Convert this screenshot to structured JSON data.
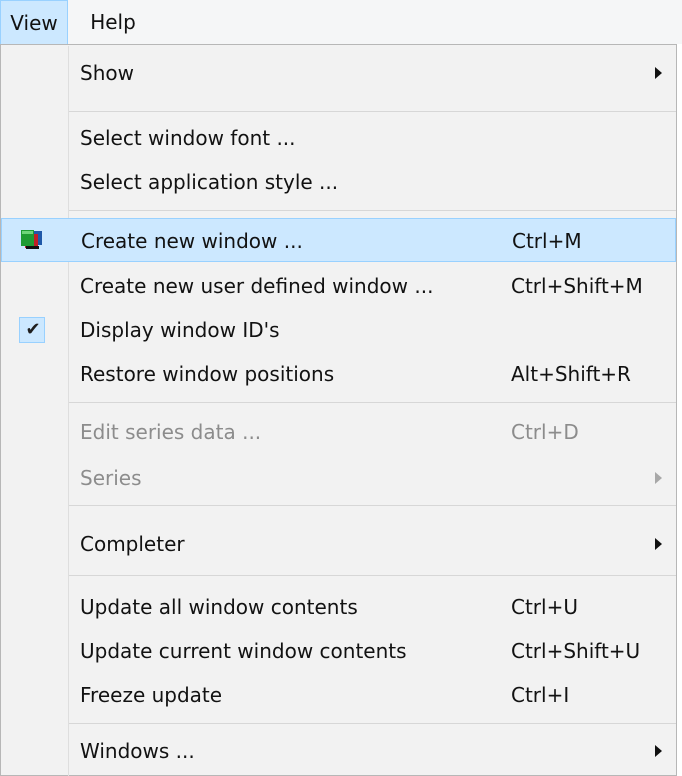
{
  "menubar": {
    "items": [
      {
        "label": "View"
      },
      {
        "label": "Help"
      }
    ]
  },
  "dropdown": {
    "items": [
      {
        "label": "Show",
        "shortcut": "",
        "submenu": true,
        "enabled": true
      },
      {
        "label": "Select window font ...",
        "shortcut": "",
        "submenu": false,
        "enabled": true
      },
      {
        "label": "Select application style ...",
        "shortcut": "",
        "submenu": false,
        "enabled": true
      },
      {
        "label": "Create new window ...",
        "shortcut": "Ctrl+M",
        "submenu": false,
        "enabled": true,
        "highlighted": true,
        "icon": "window-stack-icon"
      },
      {
        "label": "Create new user defined window ...",
        "shortcut": "Ctrl+Shift+M",
        "submenu": false,
        "enabled": true
      },
      {
        "label": "Display window ID's",
        "shortcut": "",
        "submenu": false,
        "enabled": true,
        "checked": true,
        "icon": "checkmark-icon"
      },
      {
        "label": "Restore window positions",
        "shortcut": "Alt+Shift+R",
        "submenu": false,
        "enabled": true
      },
      {
        "label": "Edit series data ...",
        "shortcut": "Ctrl+D",
        "submenu": false,
        "enabled": false
      },
      {
        "label": "Series",
        "shortcut": "",
        "submenu": true,
        "enabled": false
      },
      {
        "label": "Completer",
        "shortcut": "",
        "submenu": true,
        "enabled": true
      },
      {
        "label": "Update all window contents",
        "shortcut": "Ctrl+U",
        "submenu": false,
        "enabled": true
      },
      {
        "label": "Update current window contents",
        "shortcut": "Ctrl+Shift+U",
        "submenu": false,
        "enabled": true
      },
      {
        "label": "Freeze update",
        "shortcut": "Ctrl+I",
        "submenu": false,
        "enabled": true
      },
      {
        "label": "Windows ...",
        "shortcut": "",
        "submenu": true,
        "enabled": true
      }
    ]
  },
  "colors": {
    "menu_background": "#f2f2f2",
    "highlight": "#cce8ff",
    "highlight_border": "#99d1ff",
    "disabled_text": "#8c8c8c"
  }
}
